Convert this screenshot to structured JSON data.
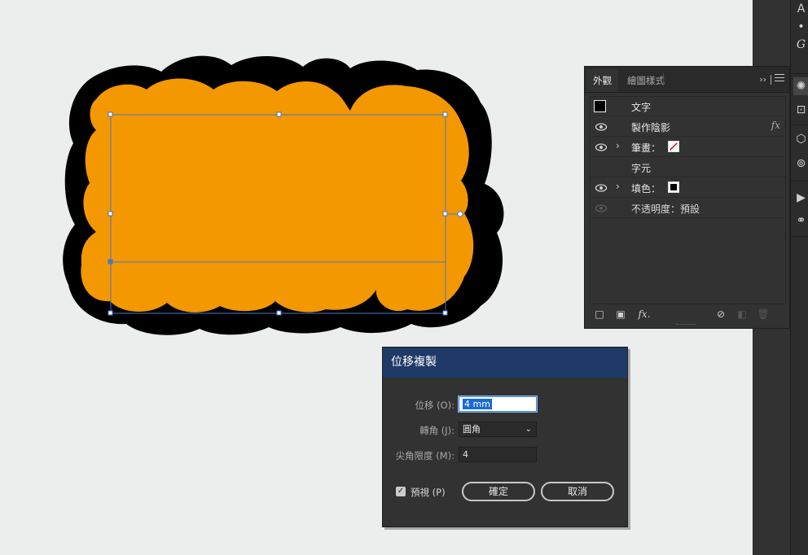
{
  "panel": {
    "tabs": [
      "外觀",
      "繪圖樣式"
    ],
    "rows": [
      {
        "label": "文字"
      },
      {
        "label": "製作陰影",
        "fx": "fx"
      },
      {
        "label": "筆畫："
      },
      {
        "label": "字元"
      },
      {
        "label": "填色："
      },
      {
        "label": "不透明度：預設"
      }
    ],
    "footer_fx": "fx."
  },
  "dialog": {
    "title": "位移複製",
    "offset_label": "位移 (O):",
    "offset_value": "4 mm",
    "joins_label": "轉角 (J):",
    "joins_value": "圓角",
    "miter_label": "尖角限度 (M):",
    "miter_value": "4",
    "preview_label": "預視 (P)",
    "preview_checked": true,
    "ok_label": "確定",
    "cancel_label": "取消"
  },
  "dock": {
    "top_letters": [
      "A",
      "•",
      "G"
    ]
  },
  "colors": {
    "shape_fill": "#f39800",
    "shape_outline": "#000000",
    "selection": "#4a76c8",
    "dialog_title_bg": "#1f3a66"
  }
}
